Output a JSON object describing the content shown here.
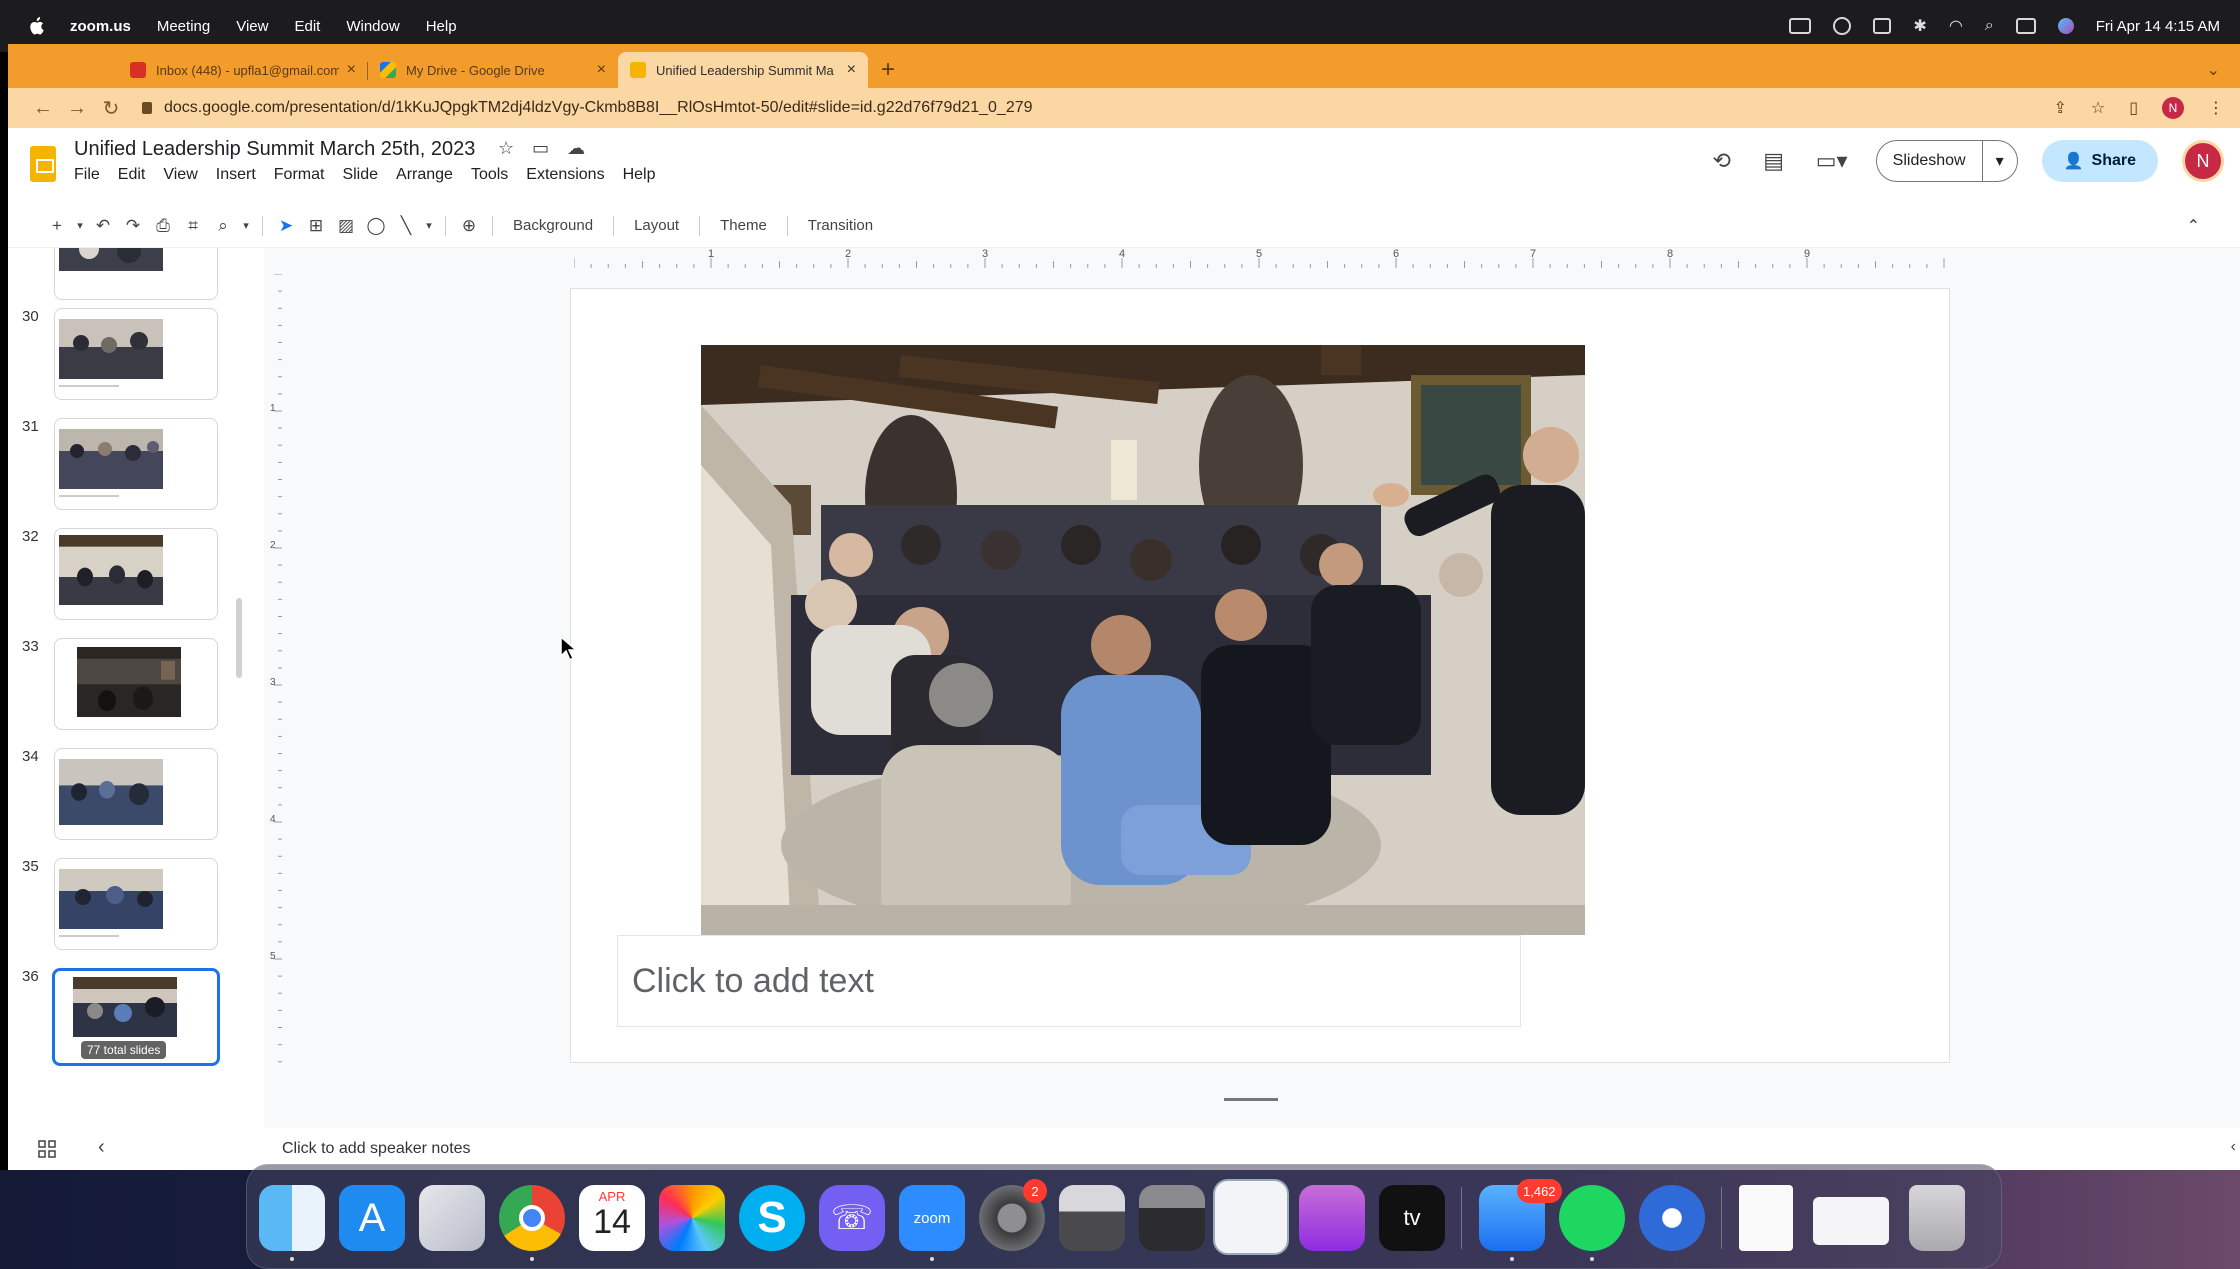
{
  "menubar": {
    "app": "zoom.us",
    "menus": [
      "Meeting",
      "View",
      "Edit",
      "Window",
      "Help"
    ],
    "datetime": "Fri Apr 14  4:15 AM"
  },
  "browser": {
    "tabs": [
      {
        "label": "Inbox (448) - upfla1@gmail.com",
        "icon_color": "#d93025"
      },
      {
        "label": "My Drive - Google Drive",
        "icon_color": "#1a73e8"
      },
      {
        "label": "Unified Leadership Summit Ma",
        "icon_color": "#f4b400"
      }
    ],
    "url": "docs.google.com/presentation/d/1kKuJQpgkTM2dj4ldzVgy-Ckmb8B8I__RlOsHmtot-50/edit#slide=id.g22d76f79d21_0_279",
    "profile_initial": "N"
  },
  "slides": {
    "title": "Unified Leadership Summit  March 25th, 2023",
    "menu": [
      "File",
      "Edit",
      "View",
      "Insert",
      "Format",
      "Slide",
      "Arrange",
      "Tools",
      "Extensions",
      "Help"
    ],
    "slideshow_label": "Slideshow",
    "share_label": "Share",
    "avatar_initial": "N",
    "toolbar_text": {
      "background": "Background",
      "layout": "Layout",
      "theme": "Theme",
      "transition": "Transition"
    },
    "ruler_ticks": [
      "1",
      "2",
      "3",
      "4",
      "5",
      "6",
      "7",
      "8",
      "9"
    ],
    "vruler_ticks": [
      "1",
      "2",
      "3",
      "4",
      "5"
    ],
    "thumbnails": [
      {
        "num": "30"
      },
      {
        "num": "31"
      },
      {
        "num": "32"
      },
      {
        "num": "33"
      },
      {
        "num": "34"
      },
      {
        "num": "35"
      },
      {
        "num": "36"
      }
    ],
    "total_slides": "77 total slides",
    "textbox_placeholder": "Click to add text",
    "speaker_notes": "Click to add speaker notes"
  },
  "dock": {
    "calendar_month": "APR",
    "calendar_day": "14",
    "settings_badge": "2",
    "mail_badge": "1,462",
    "zoom_label": "zoom"
  }
}
